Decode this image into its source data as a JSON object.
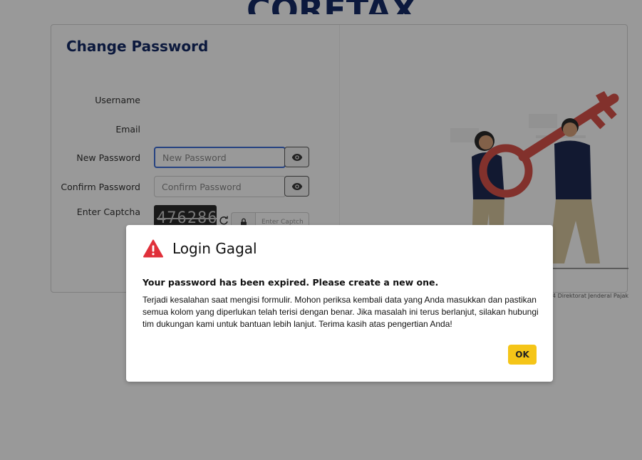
{
  "logo": {
    "text": "CORETAX"
  },
  "form": {
    "title": "Change Password",
    "username_label": "Username",
    "email_label": "Email",
    "new_password_label": "New Password",
    "new_password_placeholder": "New Password",
    "confirm_password_label": "Confirm Password",
    "confirm_password_placeholder": "Confirm Password",
    "captcha_label": "Enter Captcha",
    "captcha_text": "476286",
    "captcha_placeholder": "Enter Captcha"
  },
  "footer": {
    "copyright": "4 Direktorat Jenderal Pajak"
  },
  "dialog": {
    "title": "Login Gagal",
    "subtitle": "Your password has been expired. Please create a new one.",
    "message": "Terjadi kesalahan saat mengisi formulir. Mohon periksa kembali data yang Anda masukkan dan pastikan semua kolom yang diperlukan telah terisi dengan benar. Jika masalah ini terus berlanjut, silakan hubungi tim dukungan kami untuk bantuan lebih lanjut. Terima kasih atas pengertian Anda!",
    "ok_label": "OK"
  },
  "colors": {
    "brand_navy": "#142a66",
    "brand_yellow": "#f5c518",
    "warning_red": "#e0303a",
    "focus_blue": "#3f6fd8"
  },
  "icons": [
    "eye-icon",
    "refresh-icon",
    "lock-icon",
    "warning-icon"
  ]
}
